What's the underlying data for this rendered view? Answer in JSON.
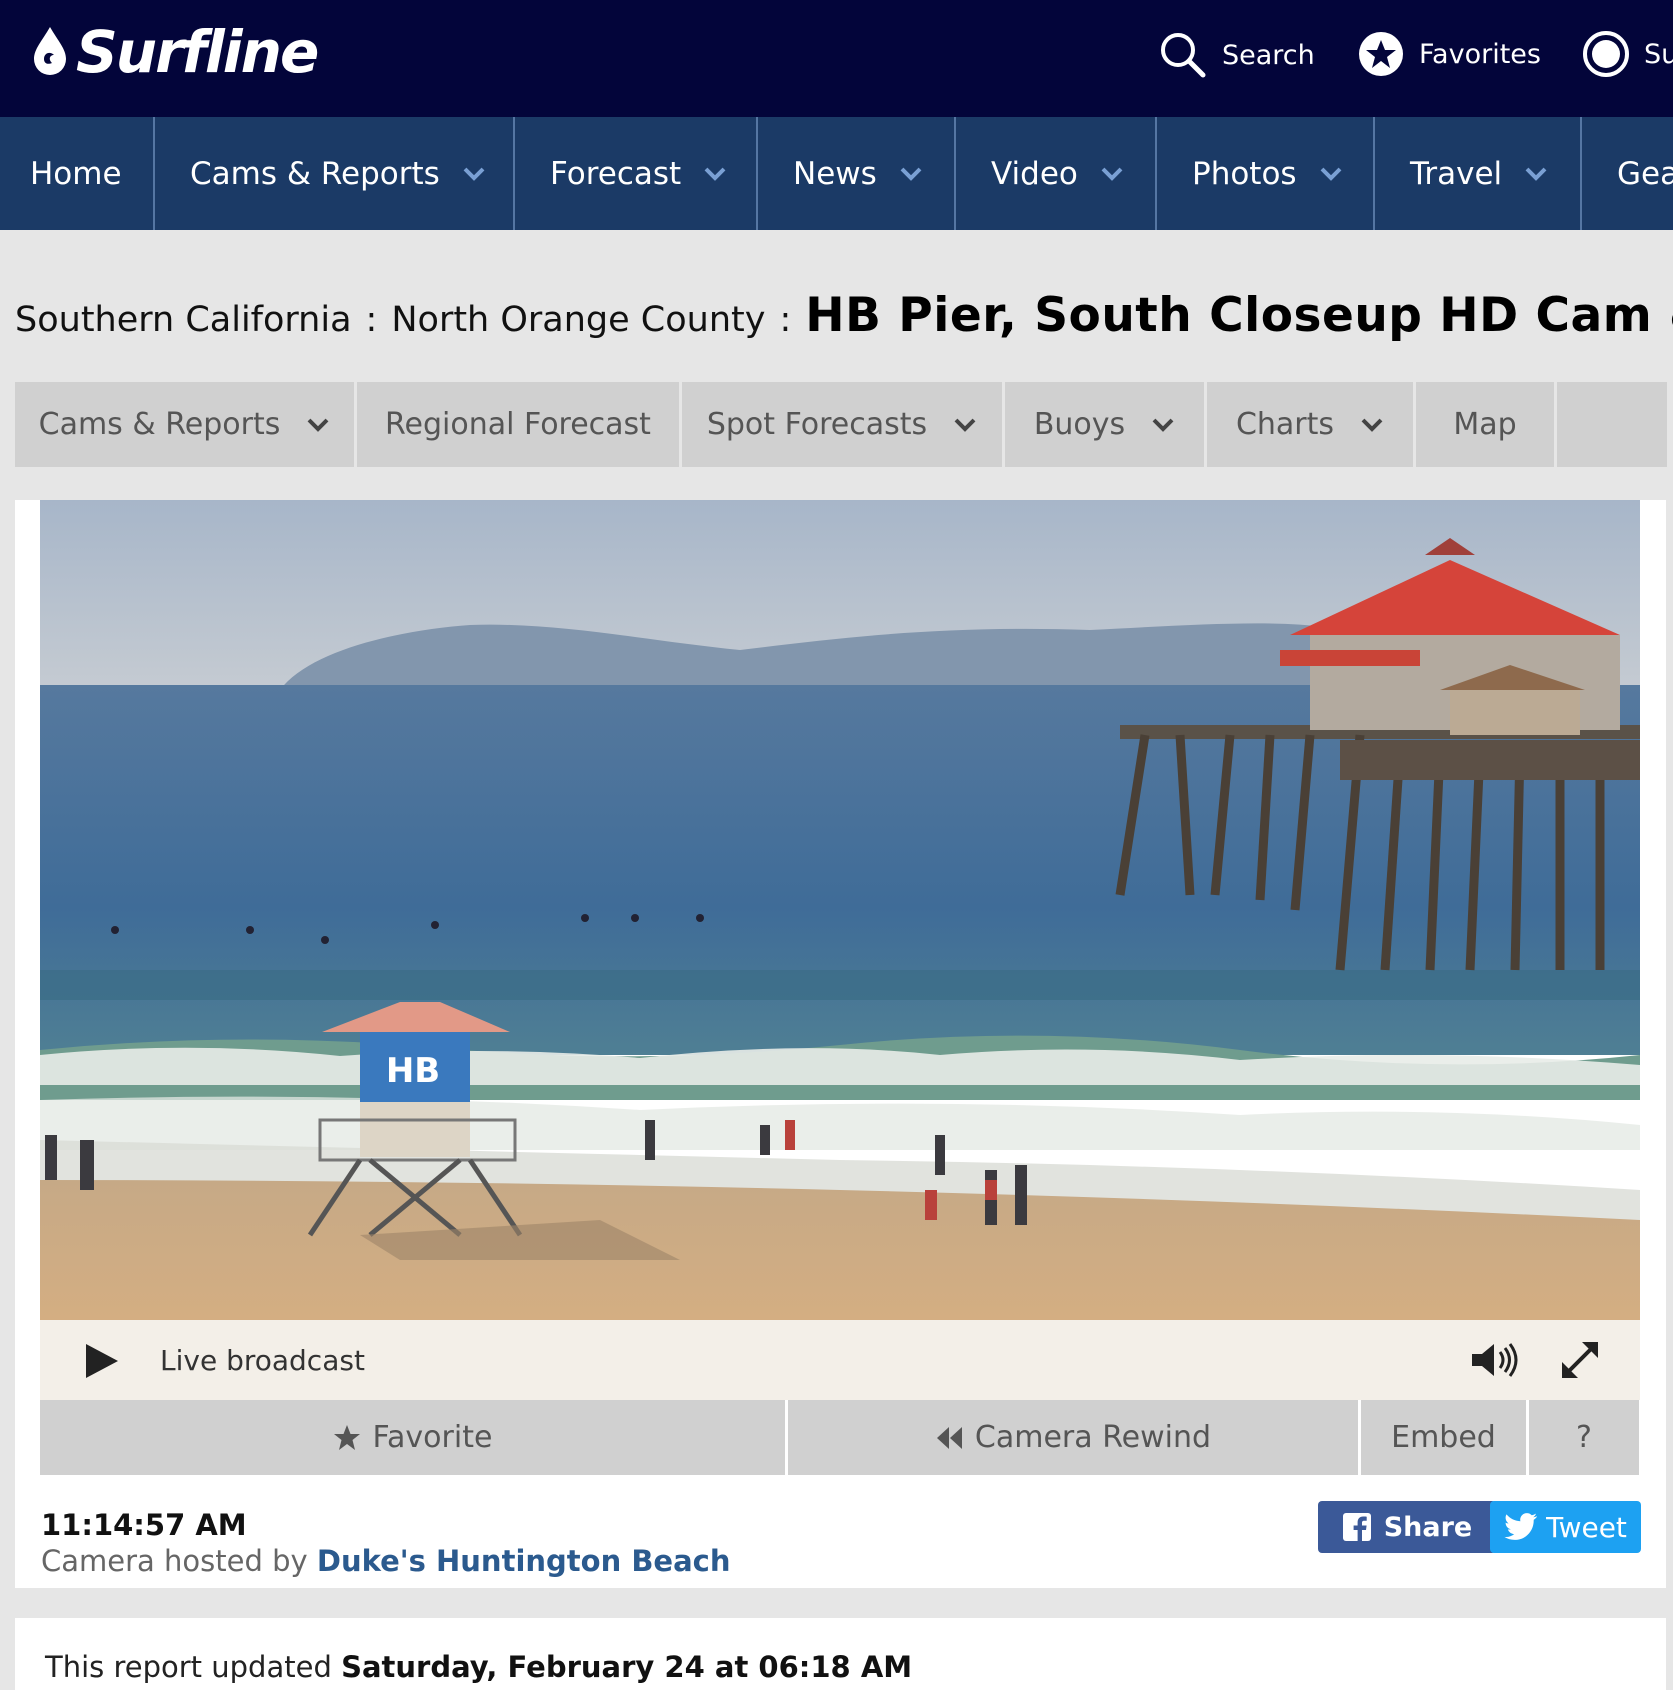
{
  "header": {
    "logo_text": "Surfline",
    "search_label": "Search",
    "favorites_label": "Favorites",
    "sub_label": "Su"
  },
  "mainnav": {
    "items": [
      {
        "label": "Home",
        "dropdown": false
      },
      {
        "label": "Cams & Reports",
        "dropdown": true
      },
      {
        "label": "Forecast",
        "dropdown": true
      },
      {
        "label": "News",
        "dropdown": true
      },
      {
        "label": "Video",
        "dropdown": true
      },
      {
        "label": "Photos",
        "dropdown": true
      },
      {
        "label": "Travel",
        "dropdown": true
      },
      {
        "label": "Gea",
        "dropdown": false
      }
    ]
  },
  "breadcrumb": {
    "region": "Southern California",
    "subregion": "North Orange County",
    "separator": ":",
    "title": "HB Pier, South Closeup HD Cam &"
  },
  "subnav": {
    "items": [
      {
        "label": "Cams & Reports",
        "dropdown": true
      },
      {
        "label": "Regional Forecast",
        "dropdown": false
      },
      {
        "label": "Spot Forecasts",
        "dropdown": true
      },
      {
        "label": "Buoys",
        "dropdown": true
      },
      {
        "label": "Charts",
        "dropdown": true
      },
      {
        "label": "Map",
        "dropdown": false
      }
    ]
  },
  "cam": {
    "tower_logo": "HB",
    "live_label": "Live broadcast",
    "favorite_label": "Favorite",
    "rewind_label": "Camera Rewind",
    "embed_label": "Embed",
    "help_label": "?",
    "time": "11:14:57 AM",
    "hosted_prefix": "Camera hosted by",
    "host_name": "Duke's Huntington Beach",
    "share_label": "Share",
    "tweet_label": "Tweet"
  },
  "report": {
    "prefix": "This report updated",
    "datetime": "Saturday, February 24 at 06:18 AM"
  },
  "colors": {
    "header_bg": "#03053a",
    "nav_bg": "#1b3a66",
    "facebook": "#3b5998",
    "twitter": "#1da1f2",
    "link": "#2b5a8e"
  }
}
